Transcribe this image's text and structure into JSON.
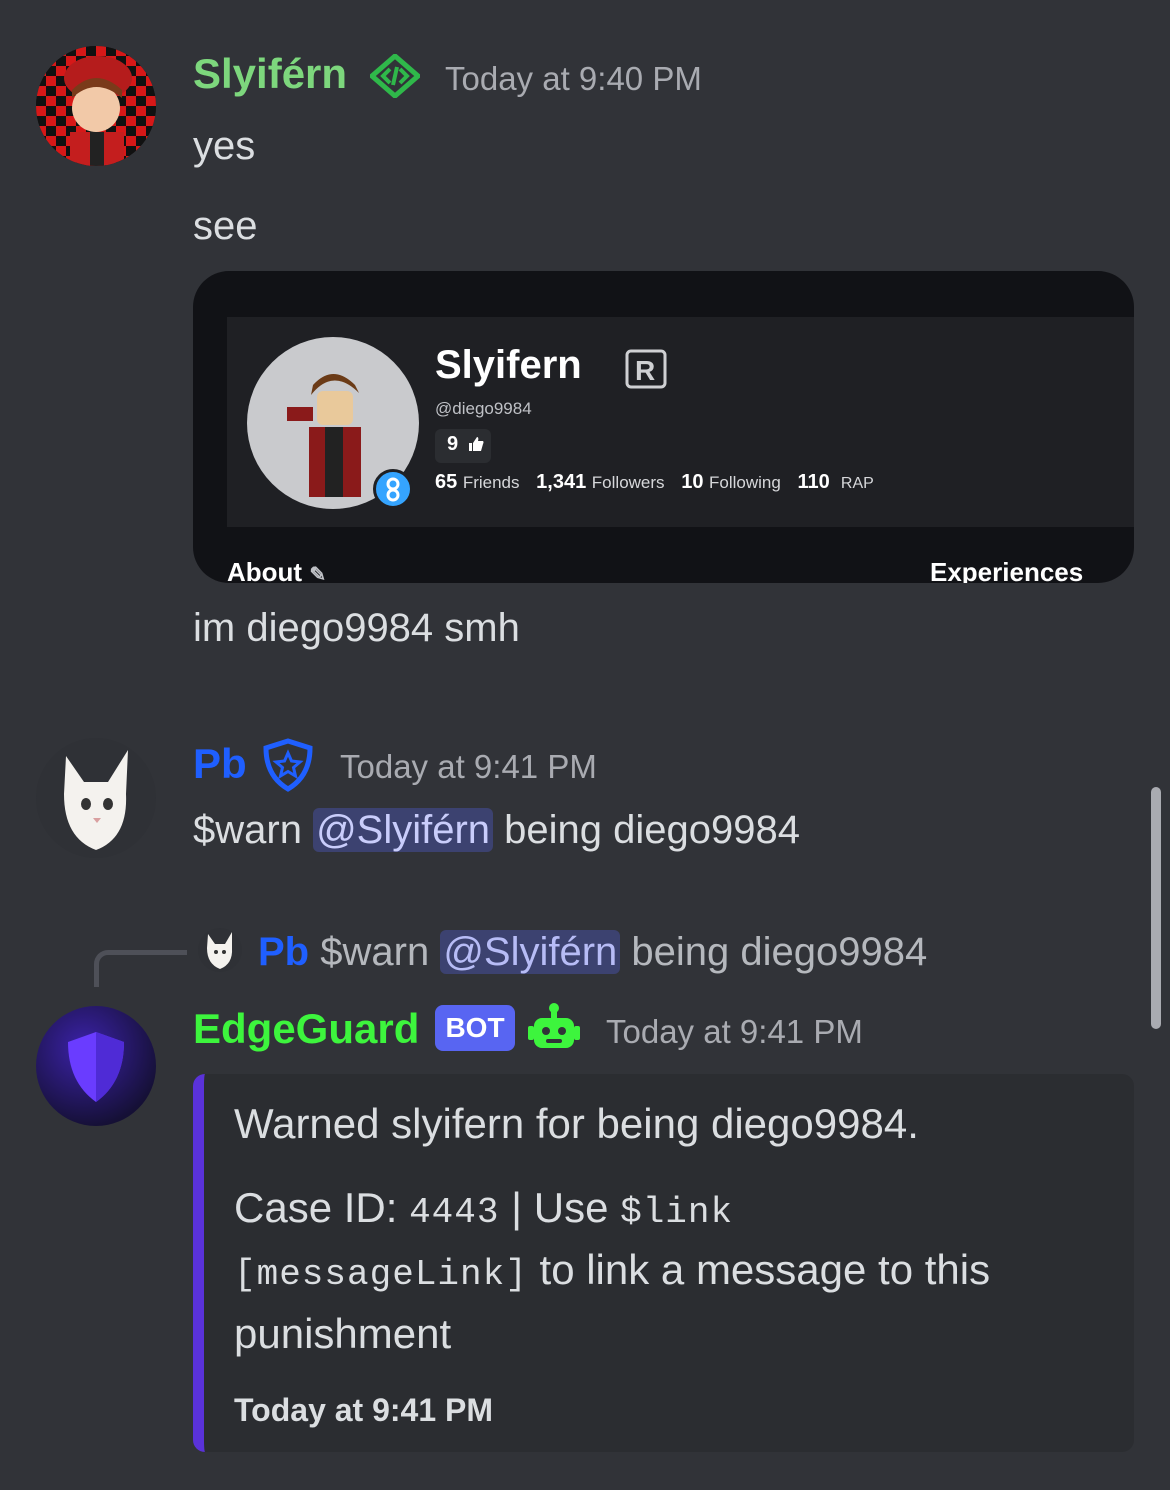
{
  "messages": {
    "m1": {
      "author": "Slyiférn",
      "author_color": "#7dd77d",
      "time": "Today at 9:40 PM",
      "lines": [
        "yes",
        "see"
      ],
      "after_image": "im diego9984 smh"
    },
    "m2": {
      "author": "Pb",
      "author_color": "#1f5fff",
      "time": "Today at 9:41 PM",
      "prefix": "$warn ",
      "mention": "@Slyiférn",
      "suffix": " being diego9984"
    },
    "m3": {
      "reply": {
        "author": "Pb",
        "prefix": "$warn ",
        "mention": "@Slyiférn",
        "suffix": " being diego9984"
      },
      "author": "EdgeGuard",
      "author_color": "#3df53d",
      "bot_badge": "BOT",
      "time": "Today at 9:41 PM",
      "embed": {
        "accent": "#5a32d9",
        "title": "Warned slyifern for being diego9984.",
        "case_label": "Case ID: ",
        "case_id": "4443",
        "use_text": " | Use ",
        "link_cmd": "$link",
        "message_link": "[messageLink]",
        "rest_1": " to link a message to this",
        "rest_2": "punishment",
        "footer": "Today at 9:41 PM"
      }
    }
  },
  "screenshot": {
    "display_name": "Slyifern",
    "handle": "@diego9984",
    "likes": "9",
    "friends_count": "65",
    "friends_label": "Friends",
    "followers_count": "1,341",
    "followers_label": "Followers",
    "following_count": "10",
    "following_label": "Following",
    "rap_count": "110",
    "rap_label": "RAP",
    "about_label": "About",
    "experiences_label": "Experiences"
  }
}
